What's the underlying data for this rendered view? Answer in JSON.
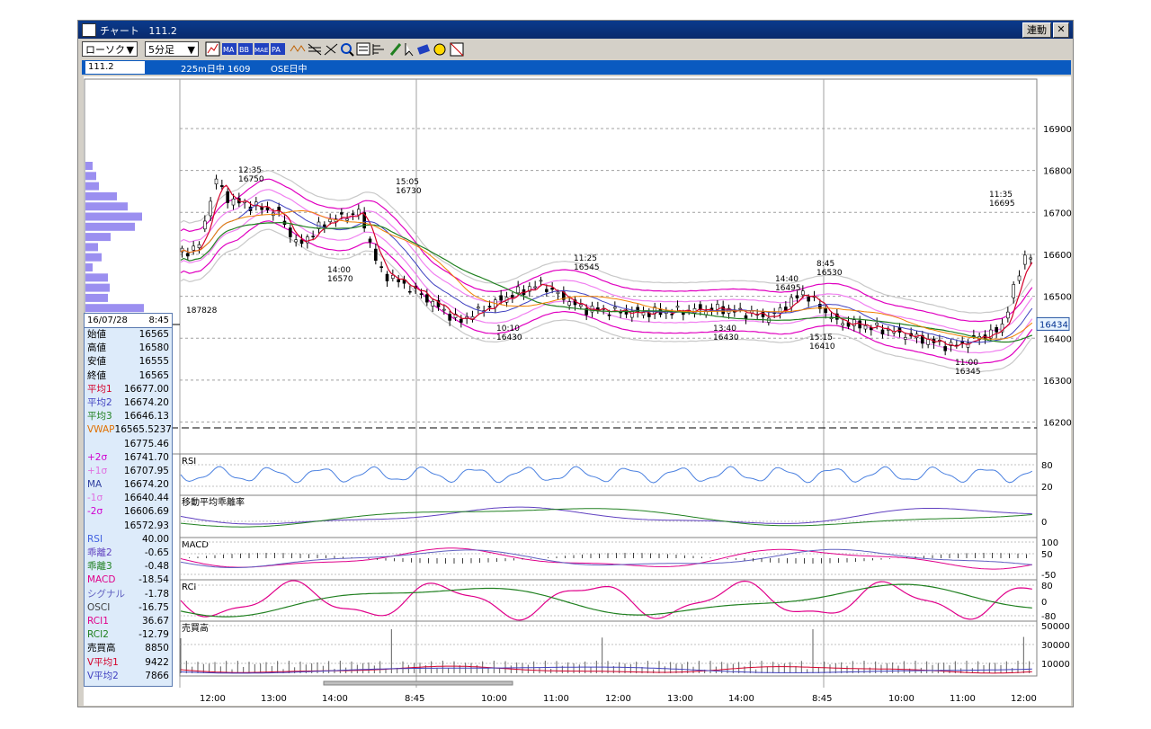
{
  "window": {
    "title": "チャート",
    "code": "111.2",
    "link_button": "連動",
    "close_label": "✕"
  },
  "toolbar": {
    "chart_type": "ローソク",
    "interval": "5分足",
    "dropdown_arrow": "▼",
    "tools": [
      "chart-settings",
      "ma",
      "bb",
      "mae",
      "pa",
      "line-tool",
      "fibo-tool",
      "zoom-tool",
      "search-tool",
      "vp-tool",
      "pen-tool",
      "cursor-tool",
      "eraser-tool",
      "smile-tool",
      "note-tool"
    ],
    "tool_labels": {
      "ma": "MA",
      "bb": "BB",
      "mae": "MAE",
      "pa": "PA"
    }
  },
  "infobar": {
    "symbol": "111.2",
    "name": "225m日中 1609",
    "market": "OSE日中"
  },
  "price_axis": {
    "ticks": [
      "16900",
      "16800",
      "16700",
      "16600",
      "16500",
      "16400",
      "16300",
      "16200"
    ],
    "current": "16434"
  },
  "indicator_axes": {
    "rsi": {
      "label": "RSI",
      "ticks": [
        "80",
        "20"
      ]
    },
    "kairi": {
      "label": "移動平均乖離率",
      "ticks": [
        "0"
      ]
    },
    "macd": {
      "label": "MACD",
      "ticks": [
        "100",
        "50",
        "-50"
      ]
    },
    "rci": {
      "label": "RCI",
      "ticks": [
        "80",
        "0",
        "-80"
      ]
    },
    "volume": {
      "label": "売買高",
      "ticks": [
        "50000",
        "30000",
        "10000"
      ]
    }
  },
  "time_axis": [
    "12:00",
    "13:00",
    "14:00",
    "8:45",
    "10:00",
    "11:00",
    "12:00",
    "13:00",
    "14:00",
    "8:45",
    "10:00",
    "11:00",
    "12:00"
  ],
  "annotations": [
    {
      "time": "12:35",
      "price": "16750"
    },
    {
      "time": "15:05",
      "price": "16730"
    },
    {
      "time": "14:00",
      "price": "16570"
    },
    {
      "time": "10:10",
      "price": "16430"
    },
    {
      "time": "11:25",
      "price": "16545"
    },
    {
      "time": "13:40",
      "price": "16430"
    },
    {
      "time": "14:40",
      "price": "16495"
    },
    {
      "time": "8:45",
      "price": "16530"
    },
    {
      "time": "15:15",
      "price": "16410"
    },
    {
      "time": "11:35",
      "price": "16695"
    },
    {
      "time": "11:00",
      "price": "16345"
    }
  ],
  "volume_profile_label": "187828",
  "data_panel": {
    "date": "16/07/28",
    "time": "8:45",
    "rows": [
      {
        "label": "始値",
        "value": "16565",
        "color": "#000000"
      },
      {
        "label": "高値",
        "value": "16580",
        "color": "#000000"
      },
      {
        "label": "安値",
        "value": "16555",
        "color": "#000000"
      },
      {
        "label": "終値",
        "value": "16565",
        "color": "#000000"
      },
      {
        "label": "平均1",
        "value": "16677.00",
        "color": "#d4002a"
      },
      {
        "label": "平均2",
        "value": "16674.20",
        "color": "#4040c0"
      },
      {
        "label": "平均3",
        "value": "16646.13",
        "color": "#208020"
      },
      {
        "label": "VWAP",
        "value": "16565.5237",
        "color": "#e07000"
      },
      {
        "label": "",
        "value": "16775.46",
        "color": "#000000"
      },
      {
        "label": "+2σ",
        "value": "16741.70",
        "color": "#d000d0"
      },
      {
        "label": "+1σ",
        "value": "16707.95",
        "color": "#e070e0"
      },
      {
        "label": "MA",
        "value": "16674.20",
        "color": "#3040a0"
      },
      {
        "label": "-1σ",
        "value": "16640.44",
        "color": "#e070e0"
      },
      {
        "label": "-2σ",
        "value": "16606.69",
        "color": "#d000d0"
      },
      {
        "label": "",
        "value": "16572.93",
        "color": "#000000"
      },
      {
        "label": "RSI",
        "value": "40.00",
        "color": "#4060e0"
      },
      {
        "label": "乖離2",
        "value": "-0.65",
        "color": "#6040c0"
      },
      {
        "label": "乖離3",
        "value": "-0.48",
        "color": "#208020"
      },
      {
        "label": "MACD",
        "value": "-18.54",
        "color": "#e0008a"
      },
      {
        "label": "シグナル",
        "value": "-1.78",
        "color": "#6060c0"
      },
      {
        "label": "OSCI",
        "value": "-16.75",
        "color": "#404040"
      },
      {
        "label": "RCI1",
        "value": "36.67",
        "color": "#e0008a"
      },
      {
        "label": "RCI2",
        "value": "-12.79",
        "color": "#208020"
      },
      {
        "label": "売買高",
        "value": "8850",
        "color": "#000000"
      },
      {
        "label": "V平均1",
        "value": "9422",
        "color": "#d4002a"
      },
      {
        "label": "V平均2",
        "value": "7866",
        "color": "#4040c0"
      }
    ]
  },
  "colors": {
    "ma1": "#d4002a",
    "ma2": "#4040c0",
    "ma3": "#208020",
    "vwap": "#f08000",
    "bb2": "#e000c0",
    "bb1": "#f080f0",
    "bb3": "#c8c8c8",
    "rsi": "#4a80e0",
    "profile": "#9b8ff0"
  }
}
